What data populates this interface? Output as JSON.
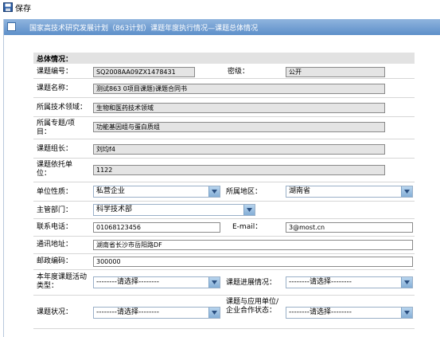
{
  "toolbar": {
    "save_label": "保存"
  },
  "panel": {
    "title": "国家高技术研究发展计划（863计划）课题年度执行情况—课题总体情况"
  },
  "section": {
    "title": "总体情况："
  },
  "fields": {
    "project_no": {
      "label": "课题编号：",
      "value": "SQ2008AA09ZX1478431"
    },
    "secrecy": {
      "label": "密级：",
      "value": "公开"
    },
    "project_name": {
      "label": "课题名称：",
      "value": "测试863 0项目课题)课题合同书"
    },
    "tech_field": {
      "label": "所属技术领域：",
      "value": "生物和医药技术领域"
    },
    "topic": {
      "label": "所属专题/项目：",
      "value": "功能基因组与蛋白质组"
    },
    "leader": {
      "label": "课题组长：",
      "value": "刘均f4"
    },
    "host_unit": {
      "label": "课题依托单位：",
      "value": "1122"
    },
    "unit_nature": {
      "label": "单位性质：",
      "value": "私营企业"
    },
    "region": {
      "label": "所属地区：",
      "value": "湖南省"
    },
    "authority": {
      "label": "主管部门：",
      "value": "科学技术部"
    },
    "phone": {
      "label": "联系电话：",
      "value": "01068123456"
    },
    "email": {
      "label": "E-mail：",
      "value": "3@most.cn"
    },
    "address": {
      "label": "通讯地址：",
      "value": "湖南省长沙市岳阳路DF"
    },
    "postcode": {
      "label": "邮政编码：",
      "value": "300000"
    },
    "activity_type": {
      "label": "本年度课题活动类型：",
      "value": "--------请选择--------"
    },
    "progress": {
      "label": "课题进展情况：",
      "value": "--------请选择--------"
    },
    "status": {
      "label": "课题状况：",
      "value": "--------请选择--------"
    },
    "coop_status": {
      "label": "课题与应用单位/企业合作状态：",
      "value": "--------请选择--------"
    }
  }
}
